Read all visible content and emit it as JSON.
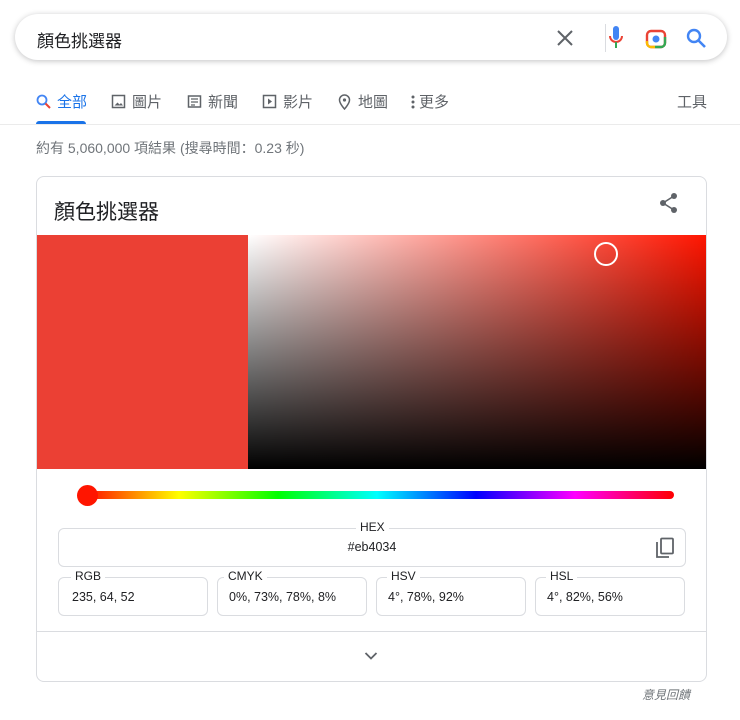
{
  "search": {
    "query": "顏色挑選器"
  },
  "tabs": [
    {
      "label": "全部",
      "icon": "search-icon"
    },
    {
      "label": "圖片",
      "icon": "image-icon"
    },
    {
      "label": "新聞",
      "icon": "news-icon"
    },
    {
      "label": "影片",
      "icon": "video-icon"
    },
    {
      "label": "地圖",
      "icon": "map-pin-icon"
    },
    {
      "label": "更多",
      "icon": "more-vert-icon"
    }
  ],
  "tools_label": "工具",
  "result_stats": "約有 5,060,000 項結果 (搜尋時間：0.23 秒)",
  "picker": {
    "title": "顏色挑選器",
    "color": "#eb4034",
    "hue_color": "#ff1500",
    "hue_degrees": 4,
    "saturation": 0.78,
    "value": 0.92,
    "hex": {
      "label": "HEX",
      "value": "#eb4034"
    },
    "fields": [
      {
        "label": "RGB",
        "value": "235, 64, 52"
      },
      {
        "label": "CMYK",
        "value": "0%, 73%, 78%, 8%"
      },
      {
        "label": "HSV",
        "value": "4°, 78%, 92%"
      },
      {
        "label": "HSL",
        "value": "4°, 82%, 56%"
      }
    ]
  },
  "feedback": "意見回饋"
}
